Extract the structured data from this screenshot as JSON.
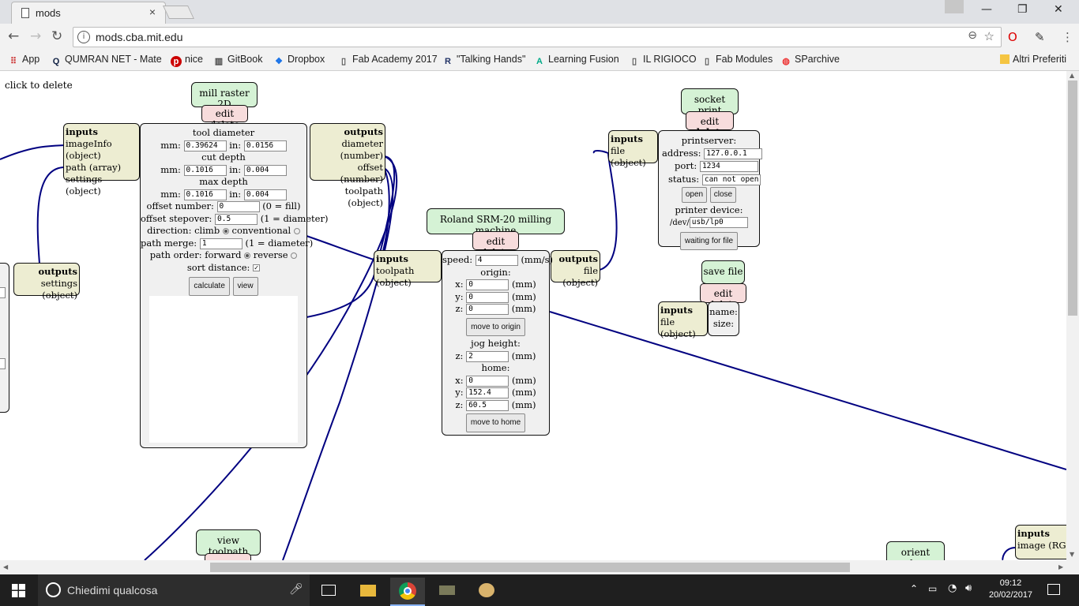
{
  "browser": {
    "tab_title": "mods",
    "tab_close": "×",
    "window_controls": [
      "—",
      "❐",
      "✕"
    ],
    "url": "mods.cba.mit.edu",
    "bookmarks": [
      {
        "label": "App",
        "icon": "apps-grid-icon"
      },
      {
        "label": "QUMRAN NET - Mate",
        "icon": "q-logo-icon"
      },
      {
        "label": "nice",
        "icon": "pinterest-icon"
      },
      {
        "label": "GitBook",
        "icon": "book-icon"
      },
      {
        "label": "Dropbox",
        "icon": "dropbox-icon"
      },
      {
        "label": "Fab Academy 2017",
        "icon": "page-icon"
      },
      {
        "label": "\"Talking Hands\"",
        "icon": "site-icon"
      },
      {
        "label": "Learning Fusion",
        "icon": "autodesk-icon"
      },
      {
        "label": "IL RIGIOCO",
        "icon": "page-icon"
      },
      {
        "label": "Fab Modules",
        "icon": "page-icon"
      },
      {
        "label": "SParchive",
        "icon": "globe-icon"
      }
    ],
    "other_bookmarks": "Altri Preferiti"
  },
  "canvas": {
    "hint": "click to delete",
    "mill_raster": {
      "title": "mill raster 2D",
      "edit_delete": "edit delete",
      "inputs": {
        "header": "inputs",
        "items": [
          "imageInfo (object)",
          "path (array)",
          "settings (object)"
        ]
      },
      "outputs": {
        "header": "outputs",
        "items": [
          "diameter (number)",
          "offset (number)",
          "toolpath (object)"
        ]
      },
      "tool_diameter": "tool diameter",
      "mm_label": "mm:",
      "in_label": "in:",
      "tool_mm": "0.39624",
      "tool_in": "0.0156",
      "cut_depth": "cut depth",
      "cut_mm": "0.1016",
      "cut_in": "0.004",
      "max_depth": "max depth",
      "max_mm": "0.1016",
      "max_in": "0.004",
      "offset_number_label": "offset number:",
      "offset_number": "0",
      "offset_number_note": "(0 = fill)",
      "offset_stepover_label": "offset stepover:",
      "offset_stepover": "0.5",
      "offset_stepover_note": "(1 = diameter)",
      "direction_label": "direction: climb",
      "direction_alt": "conventional",
      "path_merge_label": "path merge:",
      "path_merge": "1",
      "path_merge_note": "(1 = diameter)",
      "path_order_label": "path order: forward",
      "path_order_alt": "reverse",
      "sort_distance_label": "sort distance:",
      "calculate": "calculate",
      "view": "view"
    },
    "left_outputs": {
      "header": "outputs",
      "items": [
        "settings (object)"
      ]
    },
    "roland": {
      "title": "Roland SRM-20 milling machine",
      "edit_delete": "edit delete",
      "inputs": {
        "header": "inputs",
        "items": [
          "toolpath (object)"
        ]
      },
      "outputs": {
        "header": "outputs",
        "items": [
          "file (object)"
        ]
      },
      "speed_label": "speed:",
      "speed": "4",
      "speed_unit": "(mm/s)",
      "origin": "origin:",
      "x_label": "x:",
      "y_label": "y:",
      "z_label": "z:",
      "mm_unit": "(mm)",
      "origin_x": "0",
      "origin_y": "0",
      "origin_z": "0",
      "move_to_origin": "move to origin",
      "jog_height": "jog height:",
      "jog_z": "2",
      "home": "home:",
      "home_x": "0",
      "home_y": "152.4",
      "home_z": "60.5",
      "move_to_home": "move to home"
    },
    "socket_print": {
      "title": "socket print",
      "edit": "edit",
      "delete": "delete",
      "inputs": {
        "header": "inputs",
        "items": [
          "file (object)"
        ]
      },
      "printserver": "printserver:",
      "address_label": "address:",
      "address": "127.0.0.1",
      "port_label": "port:",
      "port": "1234",
      "status_label": "status:",
      "status": "can not open so",
      "open": "open",
      "close": "close",
      "printer_device": "printer device:",
      "dev_label": "/dev/",
      "device": "usb/lp0",
      "waiting": "waiting for file"
    },
    "save_file": {
      "title": "save file",
      "edit_delete": "edit delete",
      "inputs": {
        "header": "inputs",
        "items": [
          "file (object)"
        ]
      },
      "name_label": "name:",
      "size_label": "size:"
    },
    "view_toolpath": {
      "title": "view toolpath"
    },
    "orient_edges": {
      "title": "orient edges"
    },
    "right_inputs": {
      "header": "inputs",
      "items": [
        "image (RGBA)"
      ]
    }
  },
  "taskbar": {
    "search_placeholder": "Chiedimi qualcosa",
    "time": "09:12",
    "date": "20/02/2017"
  },
  "colors": {
    "wire": "#000080",
    "title_bg": "#d5f2d5",
    "edit_bg": "#f7dcdc",
    "io_bg": "#ededd2",
    "panel_bg": "#f0f0f0"
  }
}
